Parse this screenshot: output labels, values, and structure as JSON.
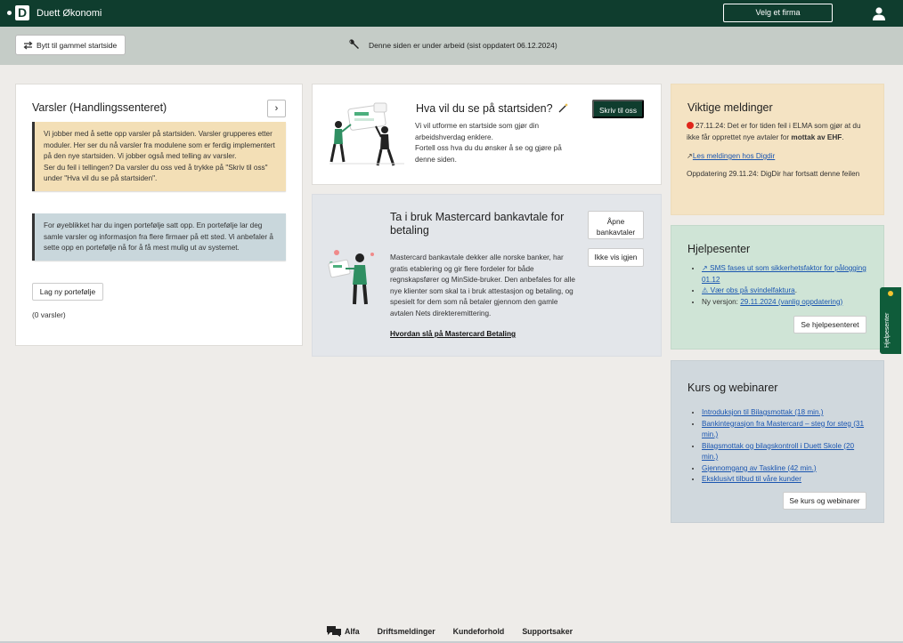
{
  "header": {
    "app_name": "Duett Økonomi",
    "logo_letter": "D",
    "firm_button": "Velg et firma",
    "user_icon": "user-icon",
    "color": "#0f3d2e"
  },
  "subbar": {
    "switch_button": "Bytt til gammel startside",
    "switch_icon": "swap-arrows-icon",
    "notice_icon": "wrench-icon",
    "notice": "Denne siden er under arbeid (sist oppdatert 06.12.2024)"
  },
  "varsler": {
    "title": "Varsler (Handlingssenteret)",
    "expand_icon": "chevron-right-icon",
    "yellow_note": "Vi jobber med å sette opp varsler på startsiden. Varsler grupperes etter moduler. Her ser du nå varsler fra modulene som er ferdig implementert på den nye startsiden. Vi jobber også med telling av varsler.",
    "yellow_note_2": "Ser du feil i tellingen? Da varsler du oss ved å trykke på \"Skriv til oss\" under \"Hva vil du se på startsiden\".",
    "blue_note": "For øyeblikket har du ingen portefølje satt opp. En portefølje lar deg samle varsler og informasjon fra flere firmaer på ett sted. Vi anbefaler å sette opp en portefølje nå for å få mest mulig ut av systemet.",
    "portfolio_button": "Lag ny portefølje",
    "count": "(0 varsler)"
  },
  "feedback": {
    "title": "Hva vil du se på startsiden?",
    "title_icon": "magic-wand-icon",
    "text_1": "Vi vil utforme en startside som gjør din arbeidshverdag enklere.",
    "text_2": "Fortell oss hva du du ønsker å se og gjøre på denne siden.",
    "button": "Skriv til oss"
  },
  "mastercard": {
    "title": "Ta i bruk Mastercard bankavtale for betaling",
    "text": "Mastercard bankavtale dekker alle norske banker, har gratis etablering og gir flere fordeler for både regnskapsfører og MinSide-bruker. Den anbefales for alle nye klienter som skal ta i bruk attestasjon og betaling, og spesielt for dem som nå betaler gjennom den gamle avtalen Nets direkteremittering.",
    "link": "Hvordan slå på Mastercard Betaling",
    "open_button": "Åpne bankavtaler",
    "hide_button": "Ikke vis igjen"
  },
  "viktige": {
    "title": "Viktige meldinger",
    "msg_1_pre": "27.11.24: Det er for tiden feil i ELMA som gjør at du ikke får opprettet nye avtaler for ",
    "msg_1_bold": "mottak av EHF",
    "msg_1_post": ".",
    "link": "Les meldingen hos Digdir",
    "msg_2": "Oppdatering 29.11.24: DigDir har fortsatt denne feilen"
  },
  "hjelpesenter": {
    "title": "Hjelpesenter",
    "item_1": "↗ SMS fases ut som sikkerhetsfaktor for pålogging 01.12",
    "item_2": "⚠ Vær obs på svindelfaktura",
    "item_3_pre": "Ny versjon: ",
    "item_3_link": "29.11.2024 (vanlig oppdatering)",
    "button": "Se hjelpesenteret"
  },
  "kurs": {
    "title": "Kurs og webinarer",
    "items": [
      "Introduksjon til Bilagsmottak (18 min.)",
      "Bankintegrasjon fra Mastercard – steg for steg (31 min.)",
      "Bilagsmottak og bilagskontroll i Duett Skole (20 min.)",
      "Gjennomgang av Taskline (42 min.)",
      "Eksklusivt tilbud til våre kunder"
    ],
    "button": "Se kurs og webinarer"
  },
  "side_tab": {
    "label": "Hjelpesenter"
  },
  "footer": {
    "items": [
      "Alfa",
      "Driftsmeldinger",
      "Kundeforhold",
      "Supportsaker"
    ]
  }
}
